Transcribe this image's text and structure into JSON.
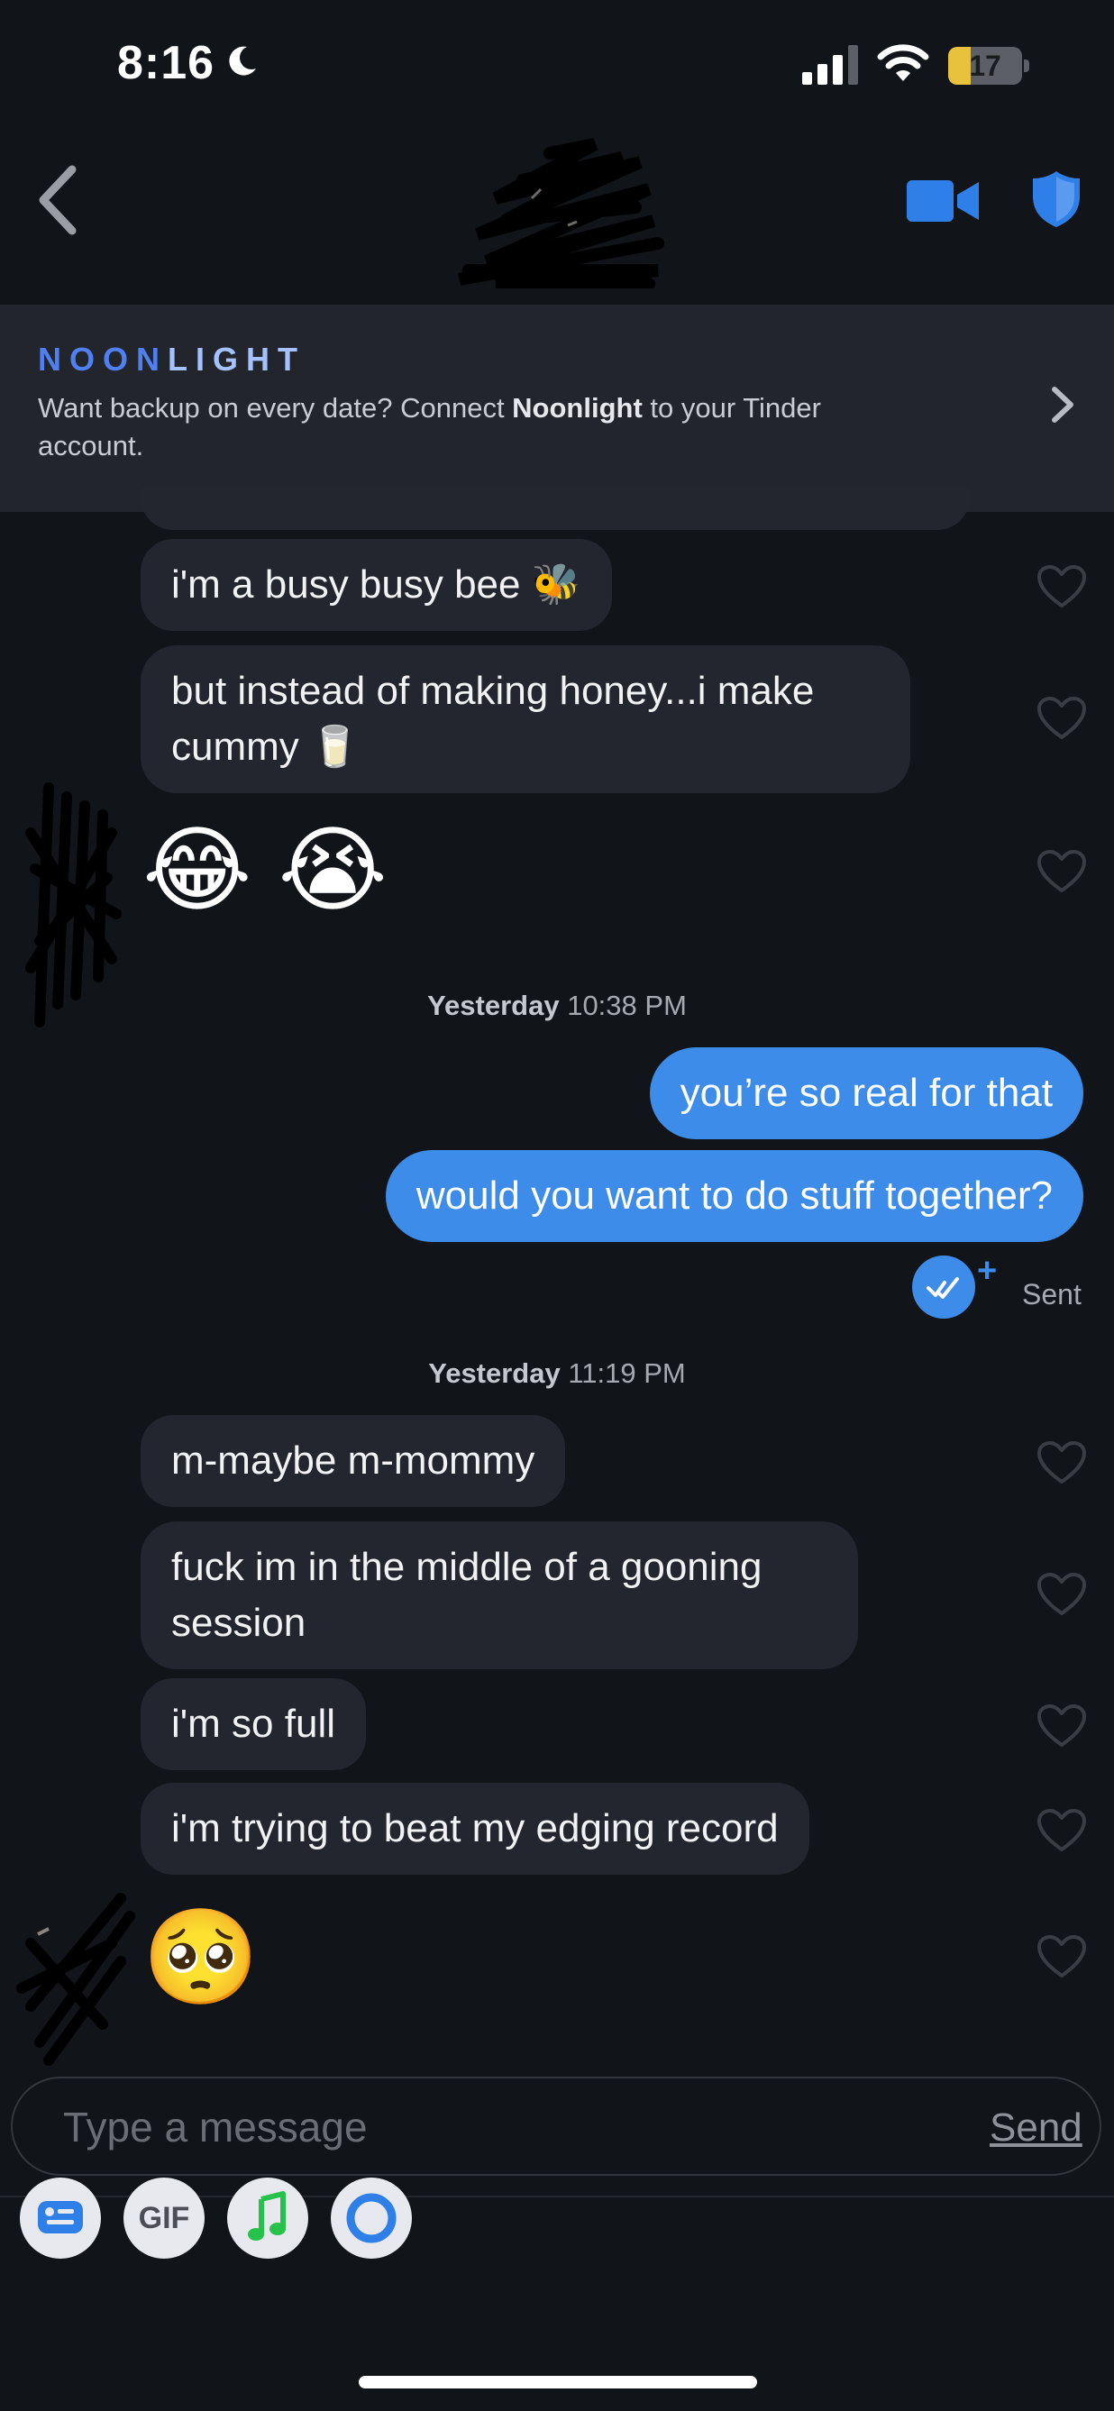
{
  "status_bar": {
    "time": "8:16",
    "battery_level": "17",
    "battery_fraction": 0.17,
    "icons": [
      "moon-icon",
      "cellular-signal-icon",
      "wifi-icon",
      "battery-icon"
    ]
  },
  "header": {
    "icons": [
      "back-chevron-icon",
      "video-call-icon",
      "safety-shield-icon"
    ]
  },
  "banner": {
    "brand_part1": "NOON",
    "brand_part2": "LIGHT",
    "text_before": "Want backup on every date? Connect ",
    "text_bold": "Noonlight",
    "text_after": " to your Tinder account."
  },
  "messages": {
    "received_1": "i'm a busy busy bee 🐝",
    "received_2_line1": "but instead of making honey...i make",
    "received_2_line2": "cummy 🥛",
    "received_3_emoji": "😂 😭",
    "timestamp_1_day": "Yesterday",
    "timestamp_1_time": "10:38 PM",
    "sent_1": "you’re so real for that",
    "sent_2": "would you want to do stuff together?",
    "sent_status": "Sent",
    "timestamp_2_day": "Yesterday",
    "timestamp_2_time": "11:19 PM",
    "received_4": "m-maybe m-mommy",
    "received_5_line1": "fuck im in the middle of a gooning",
    "received_5_line2": "session",
    "received_6": "i'm so full",
    "received_7": "i'm trying to beat my edging record",
    "received_8_emoji": "🥺"
  },
  "composer": {
    "placeholder": "Type a message",
    "send_label": "Send"
  },
  "toolbar": {
    "gif_label": "GIF",
    "icons": [
      "sticker-card-icon",
      "gif-icon",
      "music-icon",
      "circle-icon"
    ]
  },
  "colors": {
    "background": "#111418",
    "incoming_bubble": "#23262e",
    "outgoing_bubble": "#3d8ce9",
    "accent_blue": "#2f7fe8"
  }
}
